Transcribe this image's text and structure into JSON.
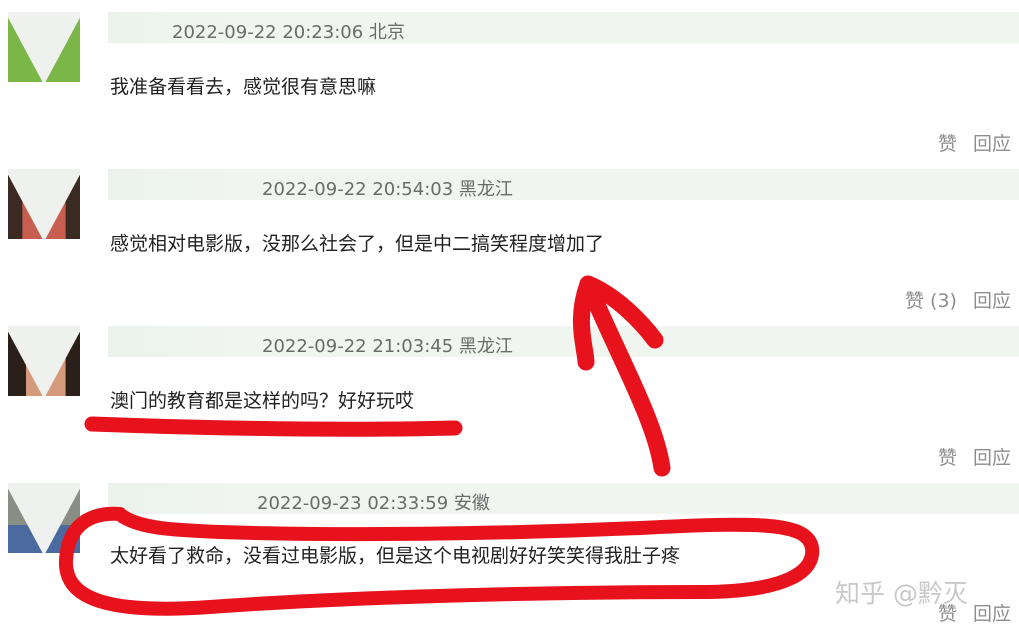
{
  "comments": [
    {
      "meta": "2022-09-22 20:23:06 北京",
      "text": "我准备看看去，感觉很有意思嘛",
      "like": "赞",
      "reply": "回应"
    },
    {
      "meta": "2022-09-22 20:54:03 黑龙江",
      "text": "感觉相对电影版，没那么社会了，但是中二搞笑程度增加了",
      "like": "赞 (3)",
      "reply": "回应"
    },
    {
      "meta": "2022-09-22 21:03:45 黑龙江",
      "text": "澳门的教育都是这样的吗？好好玩哎",
      "like": "赞",
      "reply": "回应"
    },
    {
      "meta": "2022-09-23 02:33:59 安徽",
      "text": "太好看了救命，没看过电影版，但是这个电视剧好好笑笑得我肚子疼",
      "like": "赞",
      "reply": "回应"
    }
  ],
  "watermark": "知乎 @黔灭",
  "colors": {
    "annotation_red": "#e8121c",
    "header_bg": "#f0f5f0",
    "meta_text": "#6b6b6b",
    "action_text": "#8e8e8e"
  }
}
